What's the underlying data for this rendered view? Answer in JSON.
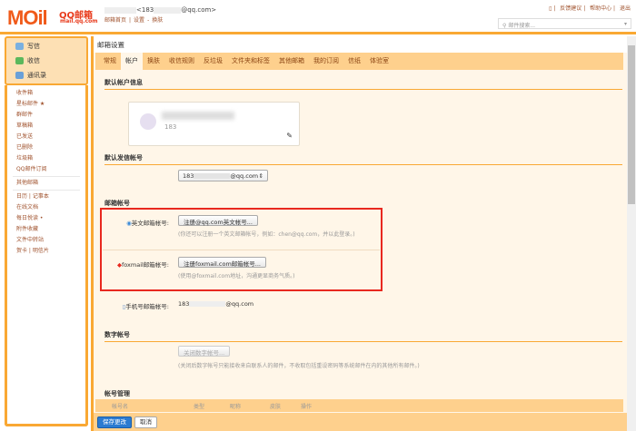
{
  "header": {
    "logo": "MOil",
    "logo_brand": "QQ邮箱",
    "logo_url": "mail.qq.com",
    "user_prefix": "<183",
    "user_suffix": "@qq.com>",
    "links": [
      "邮箱首页",
      "|",
      "设置",
      "-",
      "换肤"
    ],
    "top_links": [
      "反馈建议",
      "帮助中心",
      "退出"
    ],
    "search_placeholder": "邮件搜索..."
  },
  "sidebar": {
    "actions": [
      "写信",
      "收信",
      "通讯录"
    ],
    "folders": [
      "收件箱",
      "星标邮件 ★",
      "群邮件",
      "草稿箱",
      "已发送",
      "已删除",
      "垃圾箱",
      "QQ邮件订阅"
    ],
    "other": "其他邮箱",
    "tools": [
      "日历 | 记事本",
      "在线文档",
      "每日悦读 •",
      "附件收藏",
      "文件中转站",
      "贺卡 | 明信片"
    ]
  },
  "main": {
    "title": "邮箱设置",
    "tabs": [
      "常规",
      "帐户",
      "换肤",
      "收信规则",
      "反垃圾",
      "文件夹和标签",
      "其他邮箱",
      "我的订阅",
      "信纸",
      "体验室"
    ],
    "sec_default": "默认帐户信息",
    "uid": "183",
    "sec_sender": "默认发信帐号",
    "sender_prefix": "183",
    "sender_suffix": "@qq.com",
    "sec_accounts": "邮箱帐号",
    "english_label": "英文邮箱帐号:",
    "english_btn": "注册@qq.com英文帐号...",
    "english_hint": "(你还可以注册一个英文邮箱帐号，例如：chen@qq.com，并以此登录。)",
    "foxmail_label": "foxmail邮箱帐号:",
    "foxmail_btn": "注册foxmail.com邮箱帐号...",
    "foxmail_hint": "(使用@foxmail.com地址，沟通更显商务气质。)",
    "phone_label": "手机号邮箱帐号:",
    "phone_prefix": "183",
    "phone_suffix": "@qq.com",
    "sec_digit": "数字帐号",
    "digit_btn": "关闭数字帐号...",
    "digit_hint": "(关闭后数字帐号只能接收来自联系人的邮件，不收取包括重设密码等系统邮件在内的其他所有邮件。)",
    "sec_manage": "帐号管理",
    "columns": [
      "帐号名",
      "类型",
      "昵称",
      "皮肤",
      "操作"
    ]
  },
  "footer": {
    "save": "保存更改",
    "cancel": "取消"
  }
}
